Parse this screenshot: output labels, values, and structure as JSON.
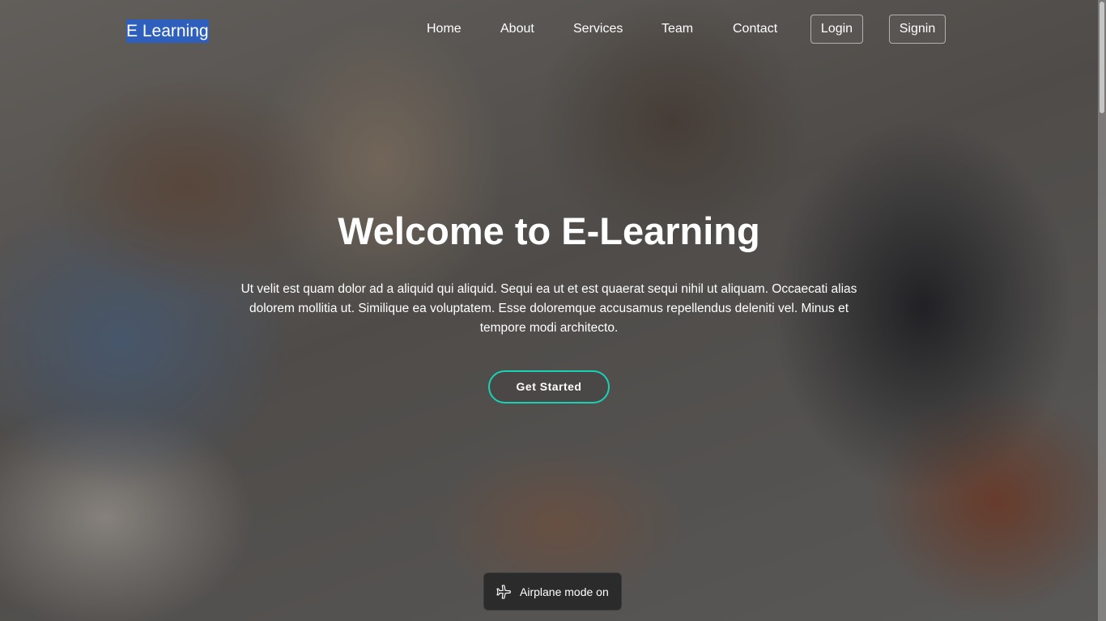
{
  "navbar": {
    "logo": "E Learning",
    "links": [
      "Home",
      "About",
      "Services",
      "Team",
      "Contact"
    ],
    "login_label": "Login",
    "signin_label": "Signin"
  },
  "hero": {
    "title": "Welcome to E-Learning",
    "description": "Ut velit est quam dolor ad a aliquid qui aliquid. Sequi ea ut et est quaerat sequi nihil ut aliquam. Occaecati alias dolorem mollitia ut. Similique ea voluptatem. Esse doloremque accusamus repellendus deleniti vel. Minus et tempore modi architecto.",
    "cta_label": "Get Started",
    "accent_color": "#18d2b6"
  },
  "toast": {
    "icon": "airplane-icon",
    "text": "Airplane mode on"
  }
}
